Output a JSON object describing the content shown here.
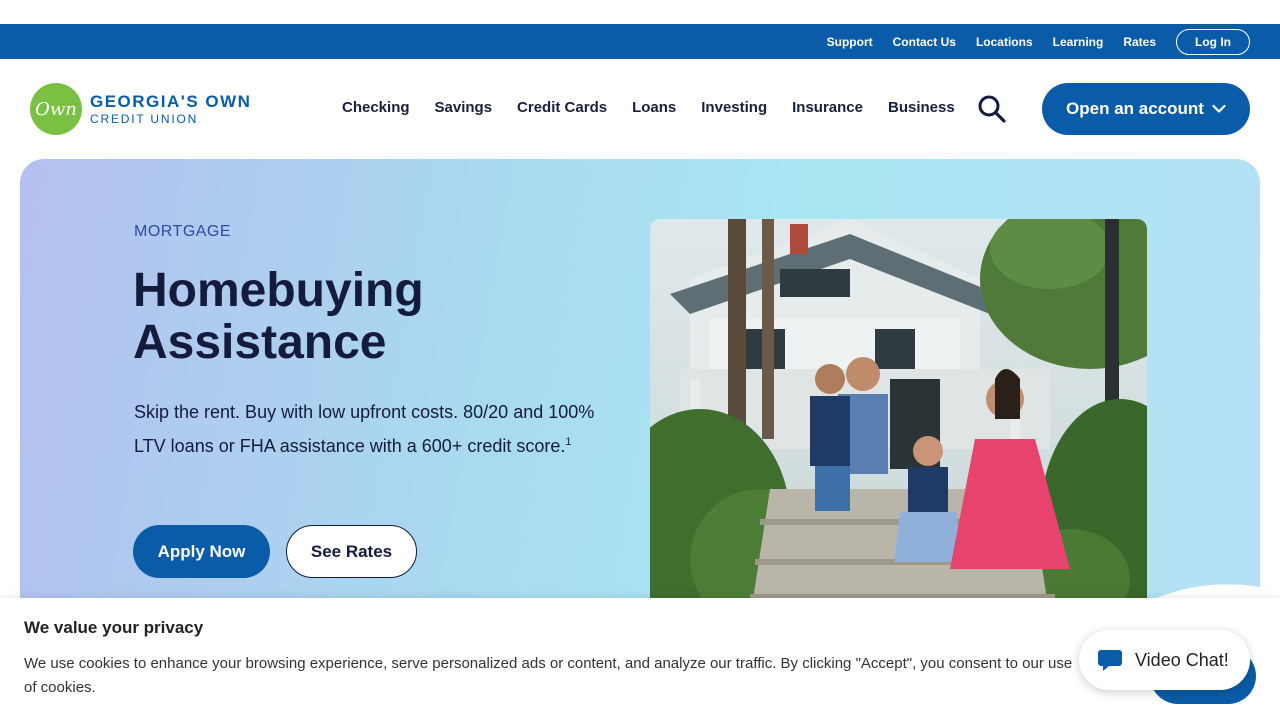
{
  "utility_nav": {
    "links": [
      "Support",
      "Contact Us",
      "Locations",
      "Learning",
      "Rates"
    ],
    "login_label": "Log In"
  },
  "header": {
    "logo_mark": "Own",
    "logo_line1": "GEORGIA'S OWN",
    "logo_line2": "CREDIT UNION",
    "nav_items": [
      "Checking",
      "Savings",
      "Credit Cards",
      "Loans",
      "Investing",
      "Insurance",
      "Business"
    ],
    "open_account_label": "Open an account"
  },
  "hero": {
    "eyebrow": "MORTGAGE",
    "title": "Homebuying Assistance",
    "description": "Skip the rent. Buy with low upfront costs. 80/20 and 100% LTV loans or FHA assistance with a 600+ credit score.",
    "footnote_marker": "1",
    "apply_label": "Apply Now",
    "rates_label": "See Rates"
  },
  "cookie_banner": {
    "title": "We value your privacy",
    "text": "We use cookies to enhance your browsing experience, serve personalized ads or content, and analyze our traffic. By clicking \"Accept\", you consent to our use of cookies."
  },
  "chat": {
    "label": "Video Chat!"
  },
  "colors": {
    "brand_blue": "#0b5ca8",
    "logo_green": "#7ac143",
    "heading_navy": "#141b3d"
  }
}
